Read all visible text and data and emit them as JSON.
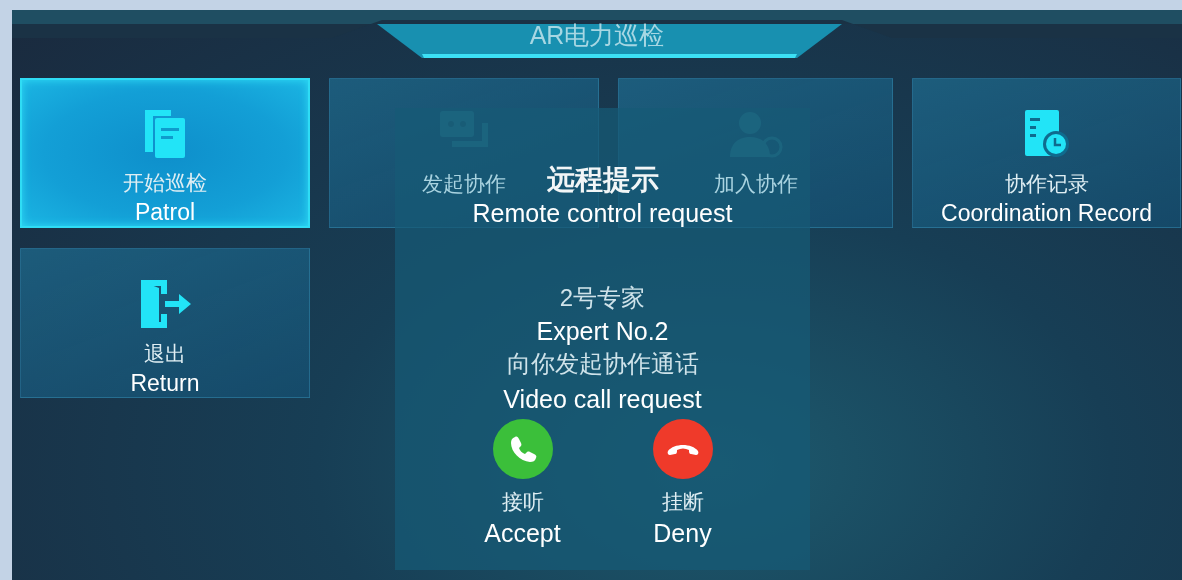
{
  "title": "AR电力巡检",
  "tiles": [
    {
      "kind": "doc",
      "label": "开始巡检",
      "caption": "Patrol",
      "selected": true
    },
    {
      "kind": "chat",
      "label": "发起协作",
      "selected": false
    },
    {
      "kind": "user",
      "label": "加入协作",
      "selected": false
    },
    {
      "kind": "record",
      "label": "协作记录",
      "caption": "Coordination Record",
      "selected": false
    },
    {
      "kind": "exit",
      "label": "退出",
      "caption": "Return",
      "selected": false
    }
  ],
  "dialog": {
    "title": "远程提示",
    "title_caption": "Remote control request",
    "caller": "2号专家",
    "caller_caption": "Expert No.2",
    "message": "向你发起协作通话",
    "message_caption": "Video call request",
    "actions": [
      {
        "kind": "accept",
        "label": "接听",
        "caption": "Accept"
      },
      {
        "kind": "decline",
        "label": "挂断",
        "caption": "Deny"
      }
    ]
  }
}
